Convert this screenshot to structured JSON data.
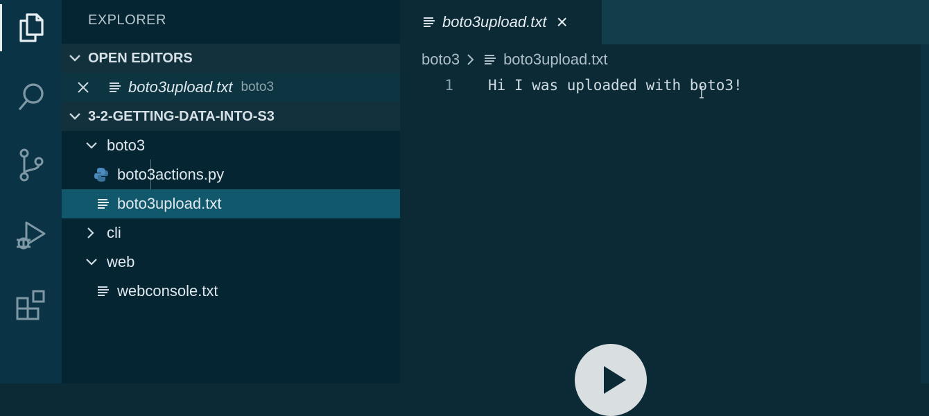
{
  "activity_bar": {
    "items": [
      {
        "name": "explorer",
        "icon": "files-icon",
        "active": true
      },
      {
        "name": "search",
        "icon": "search-icon",
        "active": false
      },
      {
        "name": "source-control",
        "icon": "source-control-icon",
        "active": false
      },
      {
        "name": "run-debug",
        "icon": "run-debug-icon",
        "active": false
      },
      {
        "name": "extensions",
        "icon": "extensions-icon",
        "active": false
      }
    ]
  },
  "sidebar": {
    "title": "EXPLORER",
    "open_editors": {
      "header": "OPEN EDITORS",
      "items": [
        {
          "filename": "boto3upload.txt",
          "folder": "boto3",
          "icon": "text-file-icon"
        }
      ]
    },
    "workspace": {
      "header": "3-2-GETTING-DATA-INTO-S3",
      "tree": [
        {
          "label": "boto3",
          "type": "folder",
          "expanded": true
        },
        {
          "label": "boto3actions.py",
          "type": "file",
          "icon": "python-icon"
        },
        {
          "label": "boto3upload.txt",
          "type": "file",
          "icon": "text-file-icon",
          "selected": true
        },
        {
          "label": "cli",
          "type": "folder",
          "expanded": false
        },
        {
          "label": "web",
          "type": "folder",
          "expanded": true
        },
        {
          "label": "webconsole.txt",
          "type": "file",
          "icon": "text-file-icon"
        }
      ]
    }
  },
  "editor": {
    "tab": {
      "label": "boto3upload.txt",
      "close": "×"
    },
    "breadcrumb": {
      "folder": "boto3",
      "file": "boto3upload.txt"
    },
    "lines": [
      {
        "number": "1",
        "text": "Hi I was uploaded with boto3!"
      }
    ]
  },
  "colors": {
    "background": "#0b2a36",
    "sidebar": "#062532",
    "activity_bar": "#0a3445",
    "selection": "#12586c",
    "python_icon": "#4b8bbe"
  }
}
